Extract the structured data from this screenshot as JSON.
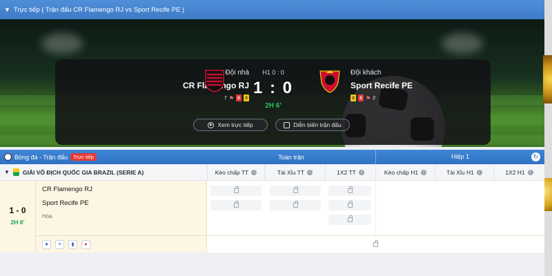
{
  "live_header": {
    "title": "Trực tiếp ( Trận đấu CR Flamengo RJ vs Sport Recife PE )"
  },
  "scoreboard": {
    "home": {
      "label": "Đội nhà",
      "name": "CR Flamengo RJ",
      "corners": "7",
      "red": "0",
      "yellow": "0"
    },
    "away": {
      "label": "Đội khách",
      "name": "Sport Recife PE",
      "corners": "2",
      "red": "0",
      "yellow": "0"
    },
    "half_score": "H1 0 : 0",
    "score": "1 : 0",
    "clock": "2H 6'",
    "btn_live": "Xem trực tiếp",
    "btn_events": "Diễn biến trận đấu"
  },
  "odds": {
    "section_title": "Bóng đá - Trận đấu",
    "live_badge": "Trực tiếp",
    "full_match": "Toàn trận",
    "half": "Hiệp 1",
    "league": "GIẢI VÔ ĐỊCH QUỐC GIA BRAZIL (SERIE A)",
    "columns": [
      "Kèo chấp TT",
      "Tài Xỉu TT",
      "1X2 TT",
      "Kèo chấp H1",
      "Tài Xỉu H1",
      "1X2 H1"
    ]
  },
  "match": {
    "score": "1 - 0",
    "time": "2H 6'",
    "home": "CR Flamengo RJ",
    "away": "Sport Recife PE",
    "draw": "Hòa"
  },
  "colors": {
    "header": "#3e7bc8",
    "live": "#e53935",
    "clock": "#22c55e"
  }
}
